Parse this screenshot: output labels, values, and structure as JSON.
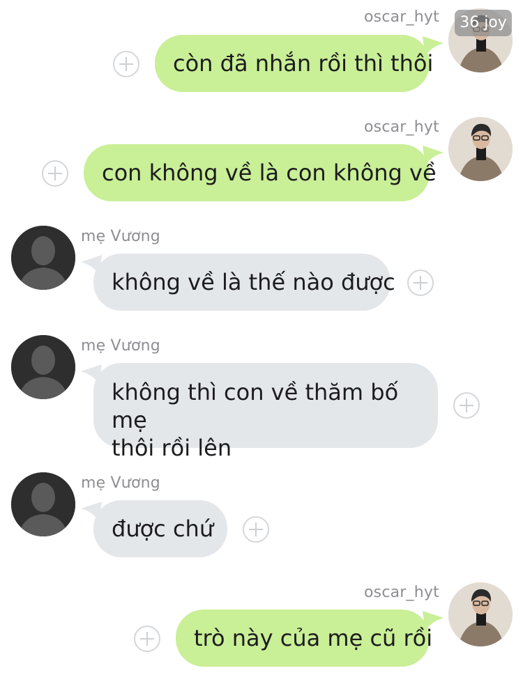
{
  "badge": "36 joy",
  "messages": [
    {
      "sender": "oscar_hyt",
      "text": "còn đã nhắn rồi thì thôi"
    },
    {
      "sender": "oscar_hyt",
      "text": "con không về là con không về"
    },
    {
      "sender": "mẹ Vương",
      "text": "không về là thế nào được"
    },
    {
      "sender": "mẹ Vương",
      "text_lines": [
        "không thì con về thăm bố mẹ",
        "thôi rồi lên"
      ]
    },
    {
      "sender": "mẹ Vương",
      "text": "được chứ"
    },
    {
      "sender": "oscar_hyt",
      "text": "trò này của mẹ cũ rồi"
    }
  ],
  "colors": {
    "outgoing_bubble": "#c9ef97",
    "incoming_bubble": "#e4e7ea",
    "sender_name": "#8e8e93"
  }
}
